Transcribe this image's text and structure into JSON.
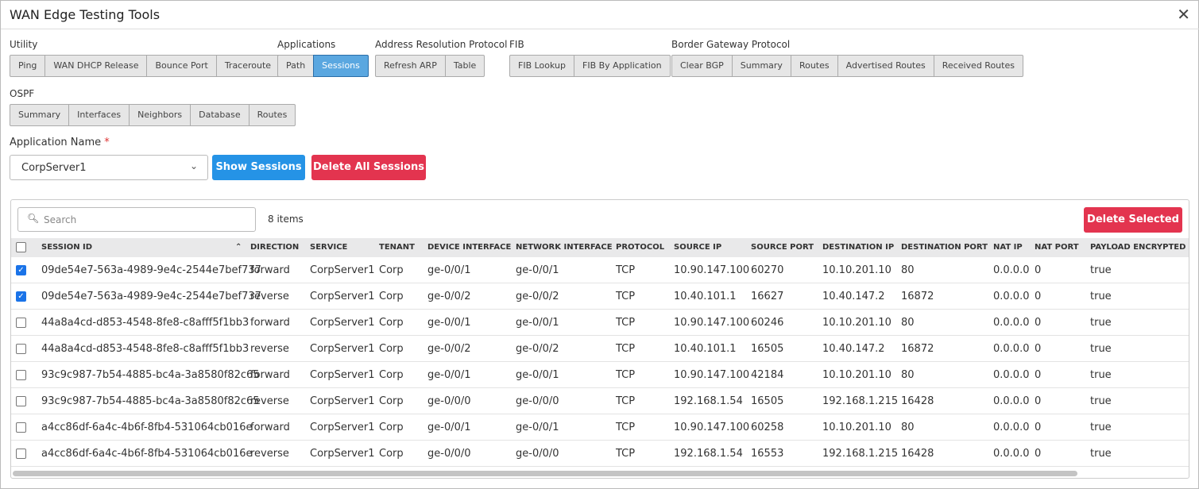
{
  "title": "WAN Edge Testing Tools",
  "groups": [
    {
      "label": "Utility",
      "buttons": [
        "Ping",
        "WAN DHCP Release",
        "Bounce Port",
        "Traceroute"
      ]
    },
    {
      "label": "Applications",
      "buttons": [
        "Path",
        "Sessions"
      ],
      "active": "Sessions"
    },
    {
      "label": "Address Resolution Protocol",
      "buttons": [
        "Refresh ARP",
        "Table"
      ]
    },
    {
      "label": "FIB",
      "buttons": [
        "FIB Lookup",
        "FIB By Application"
      ]
    },
    {
      "label": "Border Gateway Protocol",
      "buttons": [
        "Clear BGP",
        "Summary",
        "Routes",
        "Advertised Routes",
        "Received Routes"
      ]
    },
    {
      "label": "OSPF",
      "buttons": [
        "Summary",
        "Interfaces",
        "Neighbors",
        "Database",
        "Routes"
      ]
    }
  ],
  "app_name": {
    "label": "Application Name",
    "required": "*",
    "value": "CorpServer1"
  },
  "show_sessions": "Show Sessions",
  "delete_all": "Delete All Sessions",
  "delete_selected": "Delete Selected",
  "search_placeholder": "Search",
  "item_count": "8 items",
  "colors": {
    "primary": "#2593e6",
    "danger": "#e3344f",
    "active_tab": "#5aa7e0"
  },
  "columns": [
    "SESSION ID",
    "DIRECTION",
    "SERVICE",
    "TENANT",
    "DEVICE INTERFACE",
    "NETWORK INTERFACE",
    "PROTOCOL",
    "SOURCE IP",
    "SOURCE PORT",
    "DESTINATION IP",
    "DESTINATION PORT",
    "NAT IP",
    "NAT PORT",
    "PAYLOAD ENCRYPTED"
  ],
  "sort_icon": "double-chevron-up",
  "rows": [
    {
      "checked": true,
      "cells": [
        "09de54e7-563a-4989-9e4c-2544e7bef737",
        "forward",
        "CorpServer1",
        "Corp",
        "ge-0/0/1",
        "ge-0/0/1",
        "TCP",
        "10.90.147.100",
        "60270",
        "10.10.201.10",
        "80",
        "0.0.0.0",
        "0",
        "true"
      ]
    },
    {
      "checked": true,
      "cells": [
        "09de54e7-563a-4989-9e4c-2544e7bef737",
        "reverse",
        "CorpServer1",
        "Corp",
        "ge-0/0/2",
        "ge-0/0/2",
        "TCP",
        "10.40.101.1",
        "16627",
        "10.40.147.2",
        "16872",
        "0.0.0.0",
        "0",
        "true"
      ]
    },
    {
      "checked": false,
      "cells": [
        "44a8a4cd-d853-4548-8fe8-c8afff5f1bb3",
        "forward",
        "CorpServer1",
        "Corp",
        "ge-0/0/1",
        "ge-0/0/1",
        "TCP",
        "10.90.147.100",
        "60246",
        "10.10.201.10",
        "80",
        "0.0.0.0",
        "0",
        "true"
      ]
    },
    {
      "checked": false,
      "cells": [
        "44a8a4cd-d853-4548-8fe8-c8afff5f1bb3",
        "reverse",
        "CorpServer1",
        "Corp",
        "ge-0/0/2",
        "ge-0/0/2",
        "TCP",
        "10.40.101.1",
        "16505",
        "10.40.147.2",
        "16872",
        "0.0.0.0",
        "0",
        "true"
      ]
    },
    {
      "checked": false,
      "cells": [
        "93c9c987-7b54-4885-bc4a-3a8580f82c65",
        "forward",
        "CorpServer1",
        "Corp",
        "ge-0/0/1",
        "ge-0/0/1",
        "TCP",
        "10.90.147.100",
        "42184",
        "10.10.201.10",
        "80",
        "0.0.0.0",
        "0",
        "true"
      ]
    },
    {
      "checked": false,
      "cells": [
        "93c9c987-7b54-4885-bc4a-3a8580f82c65",
        "reverse",
        "CorpServer1",
        "Corp",
        "ge-0/0/0",
        "ge-0/0/0",
        "TCP",
        "192.168.1.54",
        "16505",
        "192.168.1.215",
        "16428",
        "0.0.0.0",
        "0",
        "true"
      ]
    },
    {
      "checked": false,
      "cells": [
        "a4cc86df-6a4c-4b6f-8fb4-531064cb016e",
        "forward",
        "CorpServer1",
        "Corp",
        "ge-0/0/1",
        "ge-0/0/1",
        "TCP",
        "10.90.147.100",
        "60258",
        "10.10.201.10",
        "80",
        "0.0.0.0",
        "0",
        "true"
      ]
    },
    {
      "checked": false,
      "cells": [
        "a4cc86df-6a4c-4b6f-8fb4-531064cb016e",
        "reverse",
        "CorpServer1",
        "Corp",
        "ge-0/0/0",
        "ge-0/0/0",
        "TCP",
        "192.168.1.54",
        "16553",
        "192.168.1.215",
        "16428",
        "0.0.0.0",
        "0",
        "true"
      ]
    }
  ]
}
